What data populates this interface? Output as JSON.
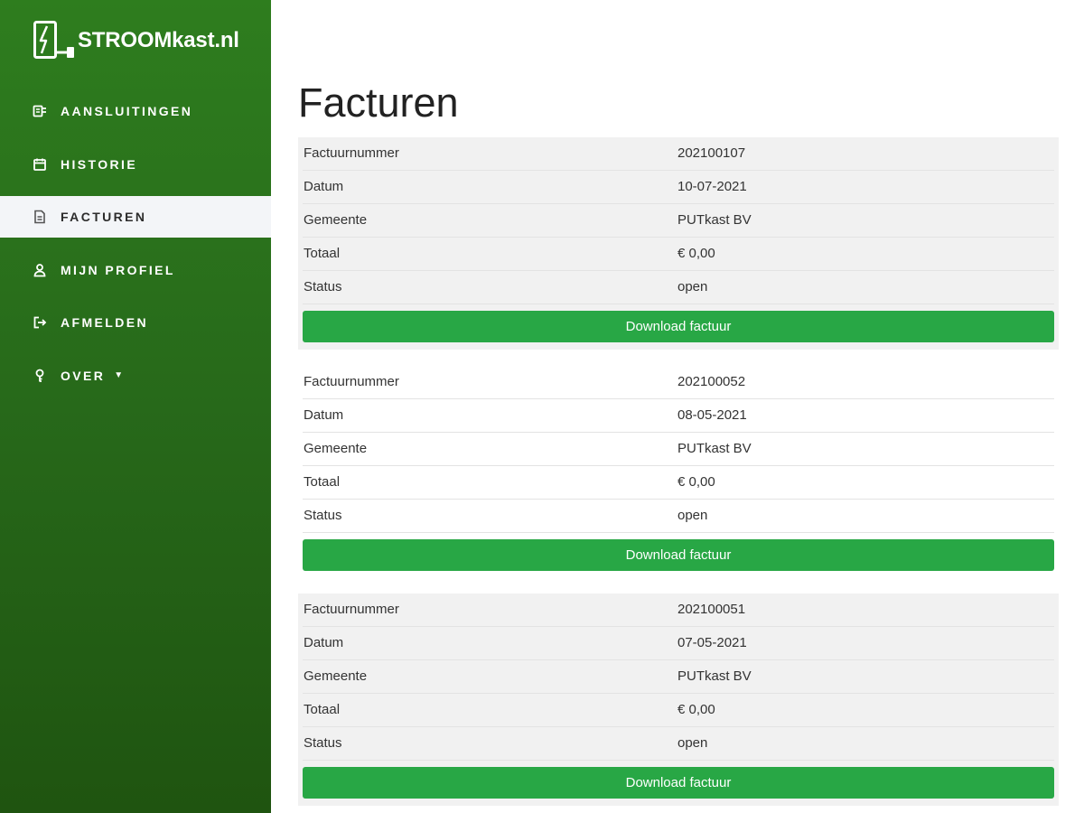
{
  "brand": {
    "name": "STROOMkast.nl"
  },
  "nav": {
    "items": [
      {
        "label": "AANSLUITINGEN",
        "icon": "plug-icon"
      },
      {
        "label": "HISTORIE",
        "icon": "calendar-icon"
      },
      {
        "label": "FACTUREN",
        "icon": "document-icon",
        "active": true
      },
      {
        "label": "MIJN PROFIEL",
        "icon": "user-icon"
      },
      {
        "label": "AFMELDEN",
        "icon": "logout-icon"
      },
      {
        "label": "OVER",
        "icon": "info-icon",
        "dropdown": true
      }
    ]
  },
  "page": {
    "title": "Facturen"
  },
  "invoices": [
    {
      "rows": [
        {
          "label": "Factuurnummer",
          "value": "202100107"
        },
        {
          "label": "Datum",
          "value": "10-07-2021"
        },
        {
          "label": "Gemeente",
          "value": "PUTkast BV"
        },
        {
          "label": "Totaal",
          "value": "€ 0,00"
        },
        {
          "label": "Status",
          "value": "open"
        }
      ],
      "button": "Download factuur"
    },
    {
      "rows": [
        {
          "label": "Factuurnummer",
          "value": "202100052"
        },
        {
          "label": "Datum",
          "value": "08-05-2021"
        },
        {
          "label": "Gemeente",
          "value": "PUTkast BV"
        },
        {
          "label": "Totaal",
          "value": "€ 0,00"
        },
        {
          "label": "Status",
          "value": "open"
        }
      ],
      "button": "Download factuur"
    },
    {
      "rows": [
        {
          "label": "Factuurnummer",
          "value": "202100051"
        },
        {
          "label": "Datum",
          "value": "07-05-2021"
        },
        {
          "label": "Gemeente",
          "value": "PUTkast BV"
        },
        {
          "label": "Totaal",
          "value": "€ 0,00"
        },
        {
          "label": "Status",
          "value": "open"
        }
      ],
      "button": "Download factuur"
    }
  ],
  "colors": {
    "sidebar": "#2e7d1e",
    "button": "#28a745",
    "active_bg": "#f3f5f8",
    "row_shade": "#f1f1f1"
  }
}
